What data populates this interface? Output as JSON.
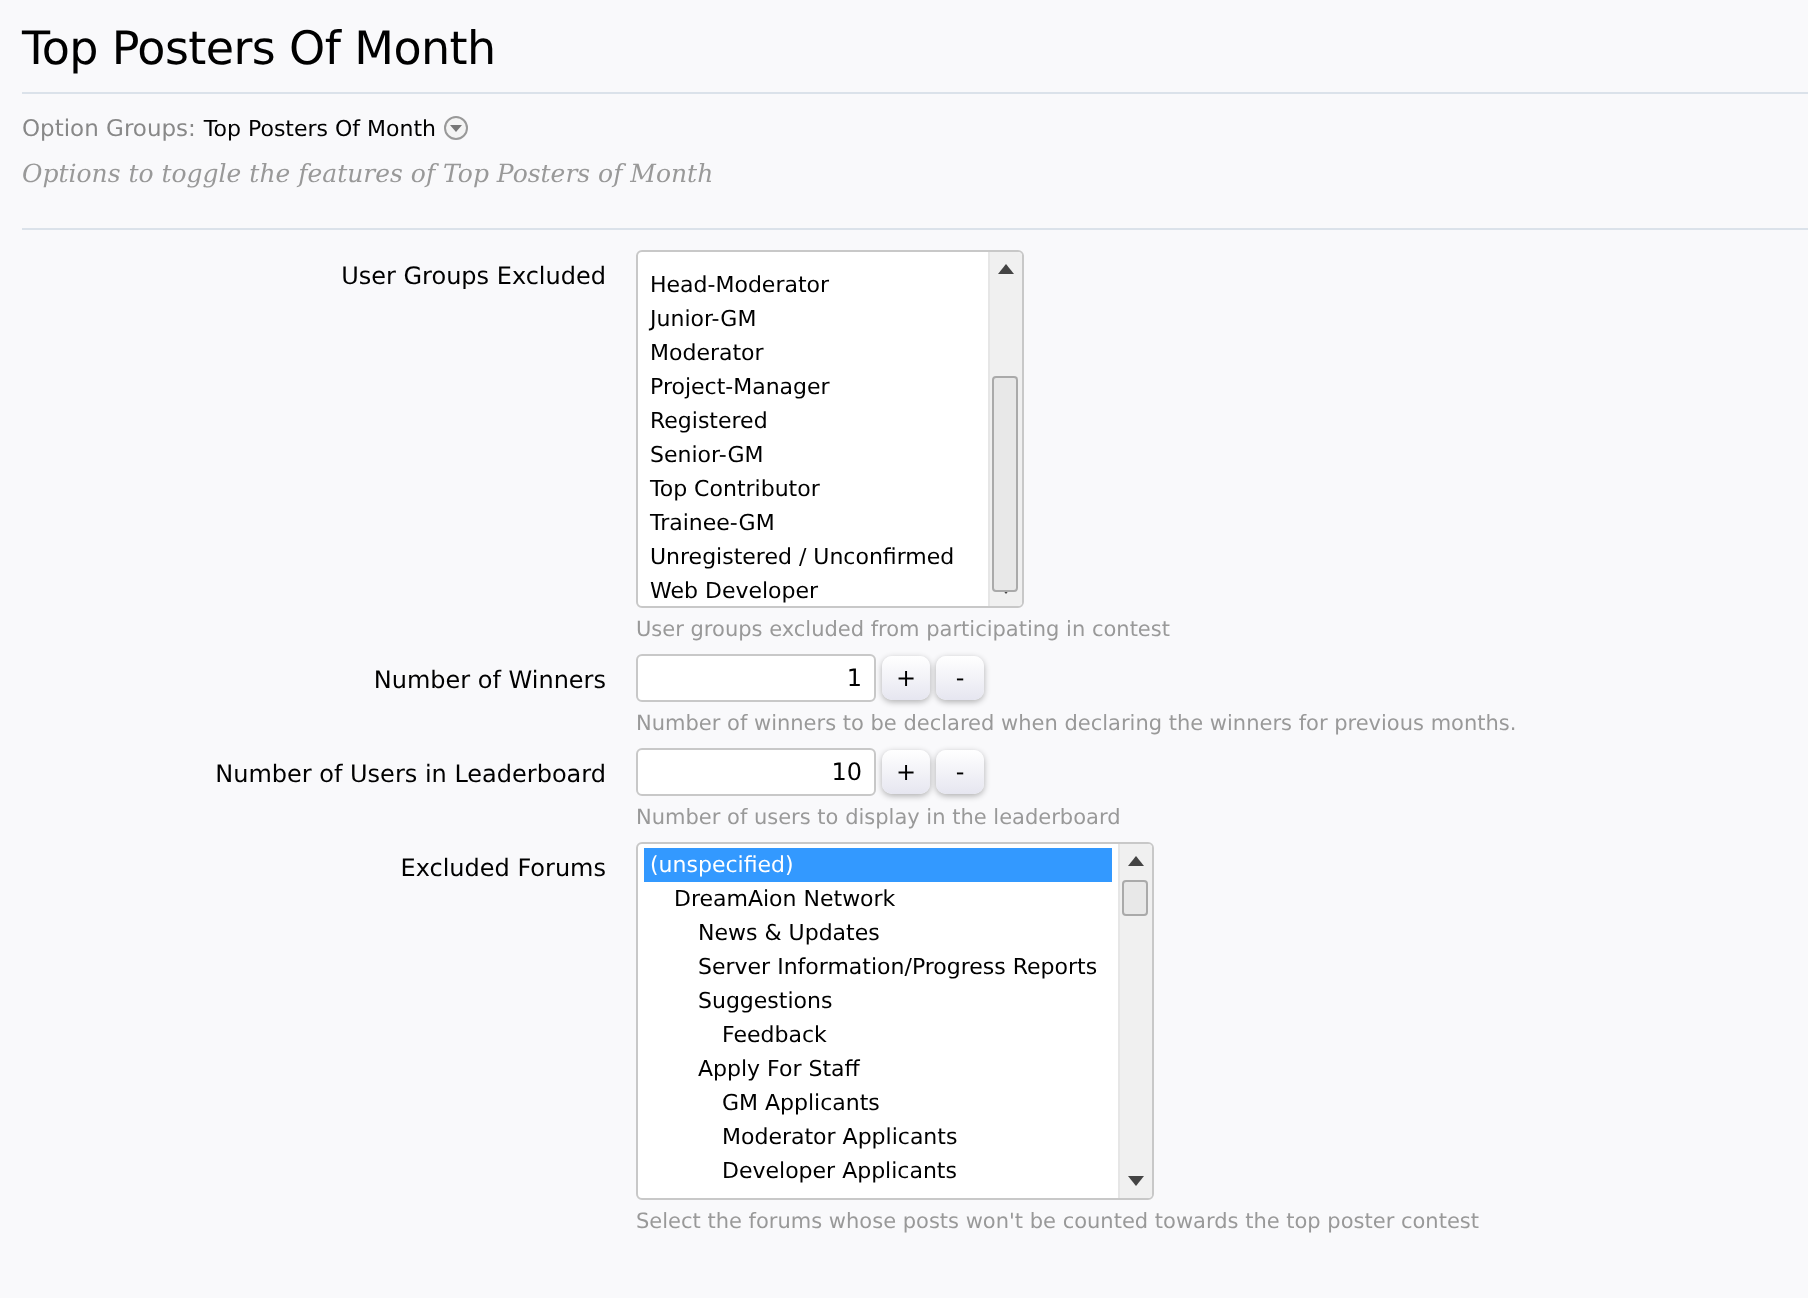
{
  "page_title": "Top Posters Of Month",
  "option_groups": {
    "label": "Option Groups:",
    "value": "Top Posters Of Month"
  },
  "description": "Options to toggle the features of Top Posters of Month",
  "options": [
    {
      "kind": "listbox",
      "label": "User Groups Excluded",
      "hint": "User groups excluded from participating in contest",
      "items": [
        {
          "label": "Head-Moderator",
          "selected": false
        },
        {
          "label": "Junior-GM",
          "selected": false
        },
        {
          "label": "Moderator",
          "selected": false
        },
        {
          "label": "Project-Manager",
          "selected": false
        },
        {
          "label": "Registered",
          "selected": false
        },
        {
          "label": "Senior-GM",
          "selected": false
        },
        {
          "label": "Top Contributor",
          "selected": false
        },
        {
          "label": "Trainee-GM",
          "selected": false
        },
        {
          "label": "Unregistered / Unconfirmed",
          "selected": false
        },
        {
          "label": "Web Developer",
          "selected": false
        }
      ]
    },
    {
      "kind": "spinner",
      "label": "Number of Winners",
      "value": "1",
      "plus": "+",
      "minus": "-",
      "hint": "Number of winners to be declared when declaring the winners for previous months."
    },
    {
      "kind": "spinner",
      "label": "Number of Users in Leaderboard",
      "value": "10",
      "plus": "+",
      "minus": "-",
      "hint": "Number of users to display in the leaderboard"
    },
    {
      "kind": "tree",
      "label": "Excluded Forums",
      "hint": "Select the forums whose posts won't be counted towards the top poster contest",
      "items": [
        {
          "kind": "none",
          "label": "(unspecified)",
          "selected": true
        },
        {
          "kind": "forum",
          "label": "DreamAion Network",
          "selected": false,
          "children": [
            {
              "label": "News & Updates",
              "selected": false
            },
            {
              "label": "Server Information/Progress Reports",
              "selected": false
            },
            {
              "label": "Suggestions",
              "selected": false,
              "children": [
                {
                  "label": "Feedback",
                  "selected": false
                }
              ]
            },
            {
              "label": "Apply For Staff",
              "selected": false,
              "children": [
                {
                  "label": "GM Applicants",
                  "selected": false
                },
                {
                  "label": "Moderator Applicants",
                  "selected": false
                },
                {
                  "label": "Developer Applicants",
                  "selected": false
                }
              ]
            }
          ]
        }
      ]
    }
  ]
}
